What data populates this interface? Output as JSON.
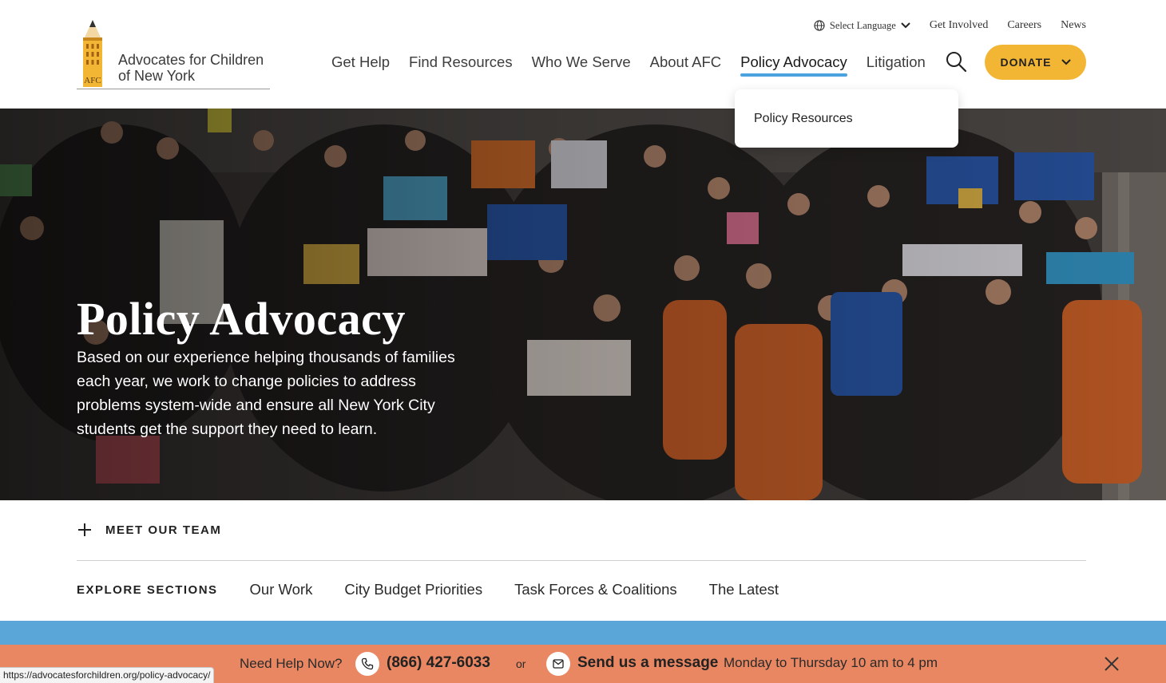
{
  "brand": {
    "name_line1": "Advocates for Children",
    "name_line2": "of New York",
    "logo_initials": "AFC",
    "colors": {
      "gold": "#f2b534",
      "blue": "#4aa3df",
      "coral": "#e98762"
    }
  },
  "utility_nav": {
    "language": "Select Language",
    "links": [
      "Get Involved",
      "Careers",
      "News"
    ]
  },
  "main_nav": {
    "items": [
      "Get Help",
      "Find Resources",
      "Who We Serve",
      "About AFC",
      "Policy Advocacy",
      "Litigation"
    ],
    "active": "Policy Advocacy",
    "donate": "DONATE"
  },
  "dropdown": {
    "items": [
      "Policy Resources"
    ]
  },
  "hero": {
    "title": "Policy Advocacy",
    "description": "Based on our experience helping thousands of families each year, we work to change policies to address problems system-wide and ensure all New York City students get the support they need to learn."
  },
  "team_toggle": "MEET OUR TEAM",
  "explore": {
    "label": "EXPLORE SECTIONS",
    "links": [
      "Our Work",
      "City Budget Priorities",
      "Task Forces & Coalitions",
      "The Latest"
    ]
  },
  "help_bar": {
    "label": "Need Help Now?",
    "phone": "(866) 427-6033",
    "or": "or",
    "message": "Send us a message",
    "hours": "Monday to Thursday 10 am to 4 pm"
  },
  "status_url": "https://advocatesforchildren.org/policy-advocacy/"
}
